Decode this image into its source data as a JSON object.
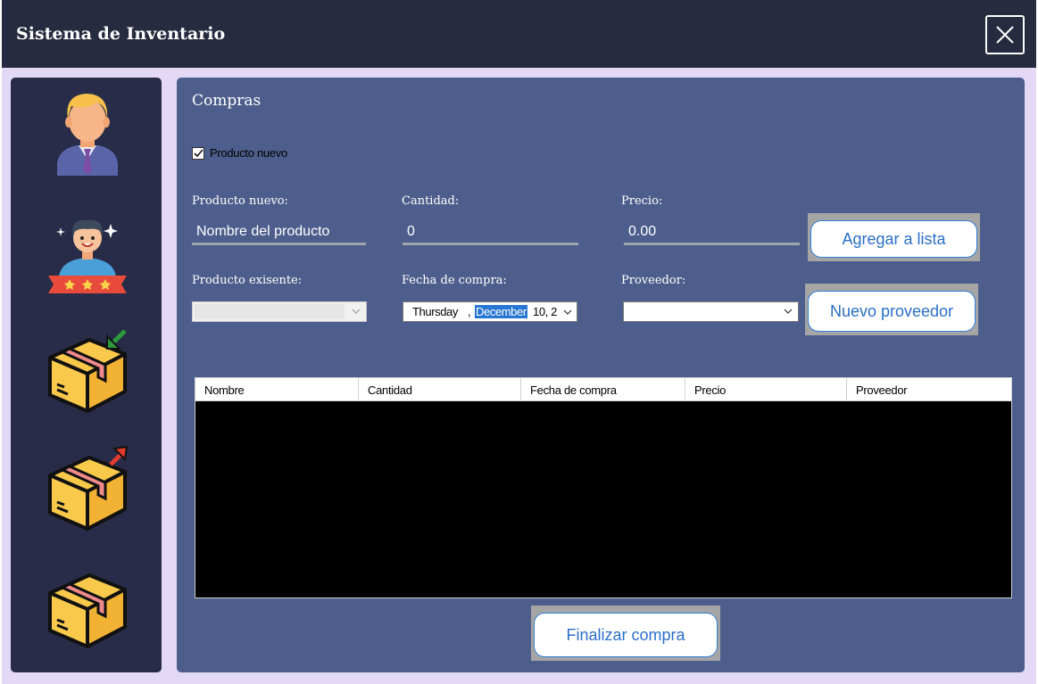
{
  "app": {
    "title": "Sistema de Inventario"
  },
  "sidebar": {
    "items": [
      {
        "name": "usuarios",
        "icon": "businessman-icon"
      },
      {
        "name": "clientes",
        "icon": "customer-rating-icon"
      },
      {
        "name": "entradas",
        "icon": "box-in-icon"
      },
      {
        "name": "salidas",
        "icon": "box-out-icon"
      },
      {
        "name": "inventario",
        "icon": "box-icon"
      }
    ]
  },
  "main": {
    "title": "Compras",
    "new_product_checkbox": {
      "label": "Producto nuevo",
      "checked": true
    },
    "fields": {
      "product_new": {
        "label": "Producto nuevo:",
        "placeholder": "Nombre del producto"
      },
      "quantity": {
        "label": "Cantidad:",
        "value": "0"
      },
      "price": {
        "label": "Precio:",
        "value": "0.00"
      },
      "existing_product": {
        "label": "Producto exisente:"
      },
      "purchase_date": {
        "label": "Fecha de compra:",
        "day": "Thursday",
        "sep": ",",
        "month": "December",
        "rest": "10, 2"
      },
      "supplier": {
        "label": "Proveedor:"
      }
    },
    "buttons": {
      "add_to_list": "Agregar a lista",
      "new_supplier": "Nuevo proveedor",
      "finish_purchase": "Finalizar compra"
    },
    "table": {
      "columns": [
        "Nombre",
        "Cantidad",
        "Fecha de compra",
        "Precio",
        "Proveedor"
      ]
    }
  },
  "colors": {
    "titlebar": "#262b3f",
    "sidebar": "#282c48",
    "panel": "#4e5e8c",
    "accent": "#2776d4"
  }
}
